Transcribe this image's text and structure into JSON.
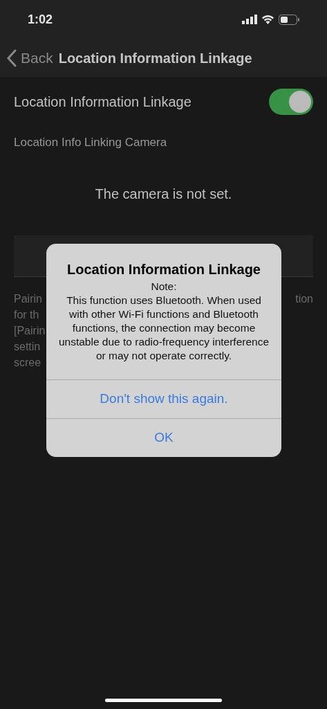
{
  "status_bar": {
    "time": "1:02"
  },
  "nav": {
    "back": "Back",
    "title": "Location Information Linkage"
  },
  "setting": {
    "label": "Location Information Linkage",
    "on": true
  },
  "section_label": "Location Info Linking Camera",
  "camera_status": "The camera is not set.",
  "description": {
    "left_fragments": [
      "Pairin",
      "for th",
      "[Pairin",
      "settin",
      "scree"
    ],
    "right_fragments": [
      "tion"
    ]
  },
  "alert": {
    "title": "Location Information Linkage",
    "message": "Note:\nThis function uses Bluetooth. When used with other Wi-Fi functions and Bluetooth functions, the connection may become unstable due to radio-frequency interference or may not operate correctly.",
    "buttons": [
      "Don't show this again.",
      "OK"
    ]
  }
}
